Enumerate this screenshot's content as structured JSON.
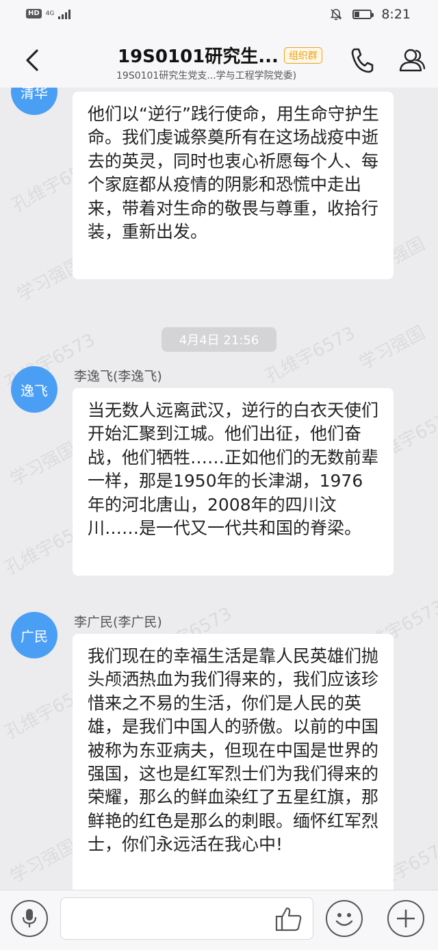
{
  "status_bar": {
    "hd": "HD",
    "network": "4G",
    "time": "8:21",
    "battery_level": 0.3,
    "icons": [
      "hd-icon",
      "signal-icon",
      "mute-bell-icon",
      "battery-icon"
    ]
  },
  "header": {
    "title": "19S0101研究生...",
    "badge": "组织群",
    "subtitle": "19S0101研究生党支...学与工程学院党委)",
    "icons": [
      "back-arrow-icon",
      "phone-icon",
      "members-icon"
    ]
  },
  "chat": {
    "messages": [
      {
        "avatar": "清华",
        "sender": "",
        "text": "他们以“逆行”践行使命，用生命守护生命。我们虔诚祭奠所有在这场战疫中逝去的英灵，同时也衷心祈愿每个人、每个家庭都从疫情的阴影和恐慌中走出来，带着对生命的敬畏与尊重，收拾行装，重新出发。"
      },
      {
        "avatar": "逸飞",
        "sender": "李逸飞(李逸飞)",
        "text": "当无数人远离武汉，逆行的白衣天使们开始汇聚到江城。他们出征，他们奋战，他们牺牲……正如他们的无数前辈一样，那是1950年的长津湖，1976年的河北唐山，2008年的四川汶川……是一代又一代共和国的脊梁。"
      },
      {
        "avatar": "广民",
        "sender": "李广民(李广民)",
        "text": "我们现在的幸福生活是靠人民英雄们抛头颅洒热血为我们得来的，我们应该珍惜来之不易的生活，你们是人民的英雄，是我们中国人的骄傲。以前的中国被称为东亚病夫，但现在中国是世界的强国，这也是红军烈士们为我们得来的荣耀，那么的鲜血染红了五星红旗，那鲜艳的红色是那么的刺眼。缅怀红军烈士，你们永远活在我心中!"
      }
    ],
    "timestamp": "4月4日 21:56",
    "watermarks": [
      "孔维宇6573",
      "学习强国"
    ]
  },
  "input_bar": {
    "placeholder": "",
    "icons": [
      "microphone-icon",
      "thumbs-up-icon",
      "emoji-icon",
      "plus-icon"
    ]
  },
  "colors": {
    "accent": "#4a9ff5",
    "badge": "#e8a21a",
    "background": "#ececef"
  }
}
